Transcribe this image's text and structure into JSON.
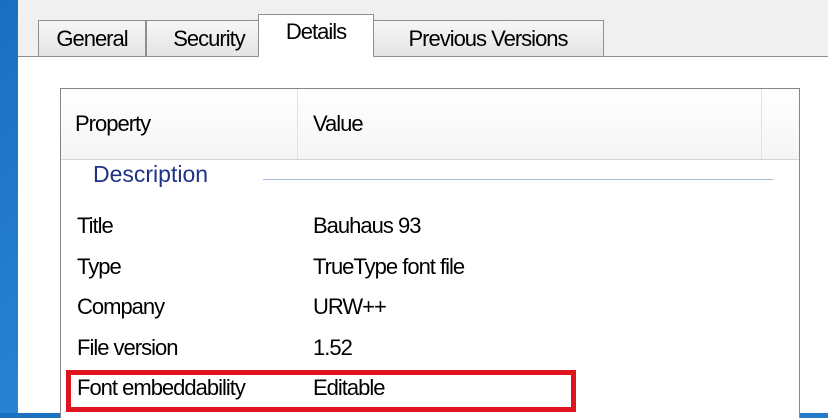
{
  "tabs": [
    {
      "label": "General",
      "active": false
    },
    {
      "label": "Security",
      "active": false
    },
    {
      "label": "Details",
      "active": true
    },
    {
      "label": "Previous Versions",
      "active": false
    }
  ],
  "columns": {
    "property": "Property",
    "value": "Value"
  },
  "group": {
    "label": "Description"
  },
  "rows": [
    {
      "property": "Title",
      "value": "Bauhaus 93"
    },
    {
      "property": "Type",
      "value": "TrueType font file"
    },
    {
      "property": "Company",
      "value": "URW++"
    },
    {
      "property": "File version",
      "value": "1.52"
    },
    {
      "property": "Font embeddability",
      "value": "Editable"
    }
  ],
  "colors": {
    "highlight": "#e0141e",
    "group_text": "#1e3287"
  }
}
